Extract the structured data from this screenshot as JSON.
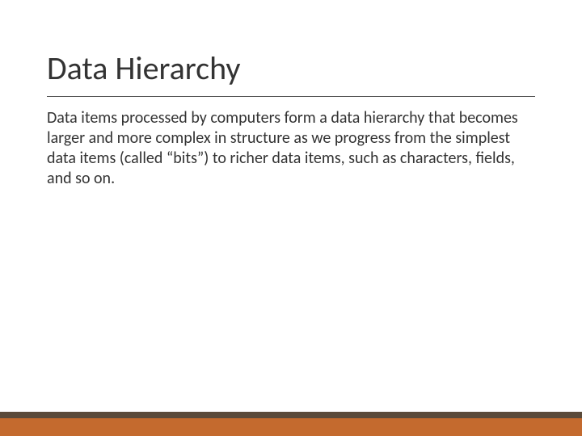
{
  "slide": {
    "title": "Data Hierarchy",
    "body": "Data items processed by computers form a data hierarchy that becomes larger and more complex in structure as we progress from the simplest data items (called “bits”) to richer data items, such as characters, fields, and so on."
  },
  "theme": {
    "footer_top_color": "#5a4a3a",
    "footer_bottom_color": "#c46a2e"
  }
}
